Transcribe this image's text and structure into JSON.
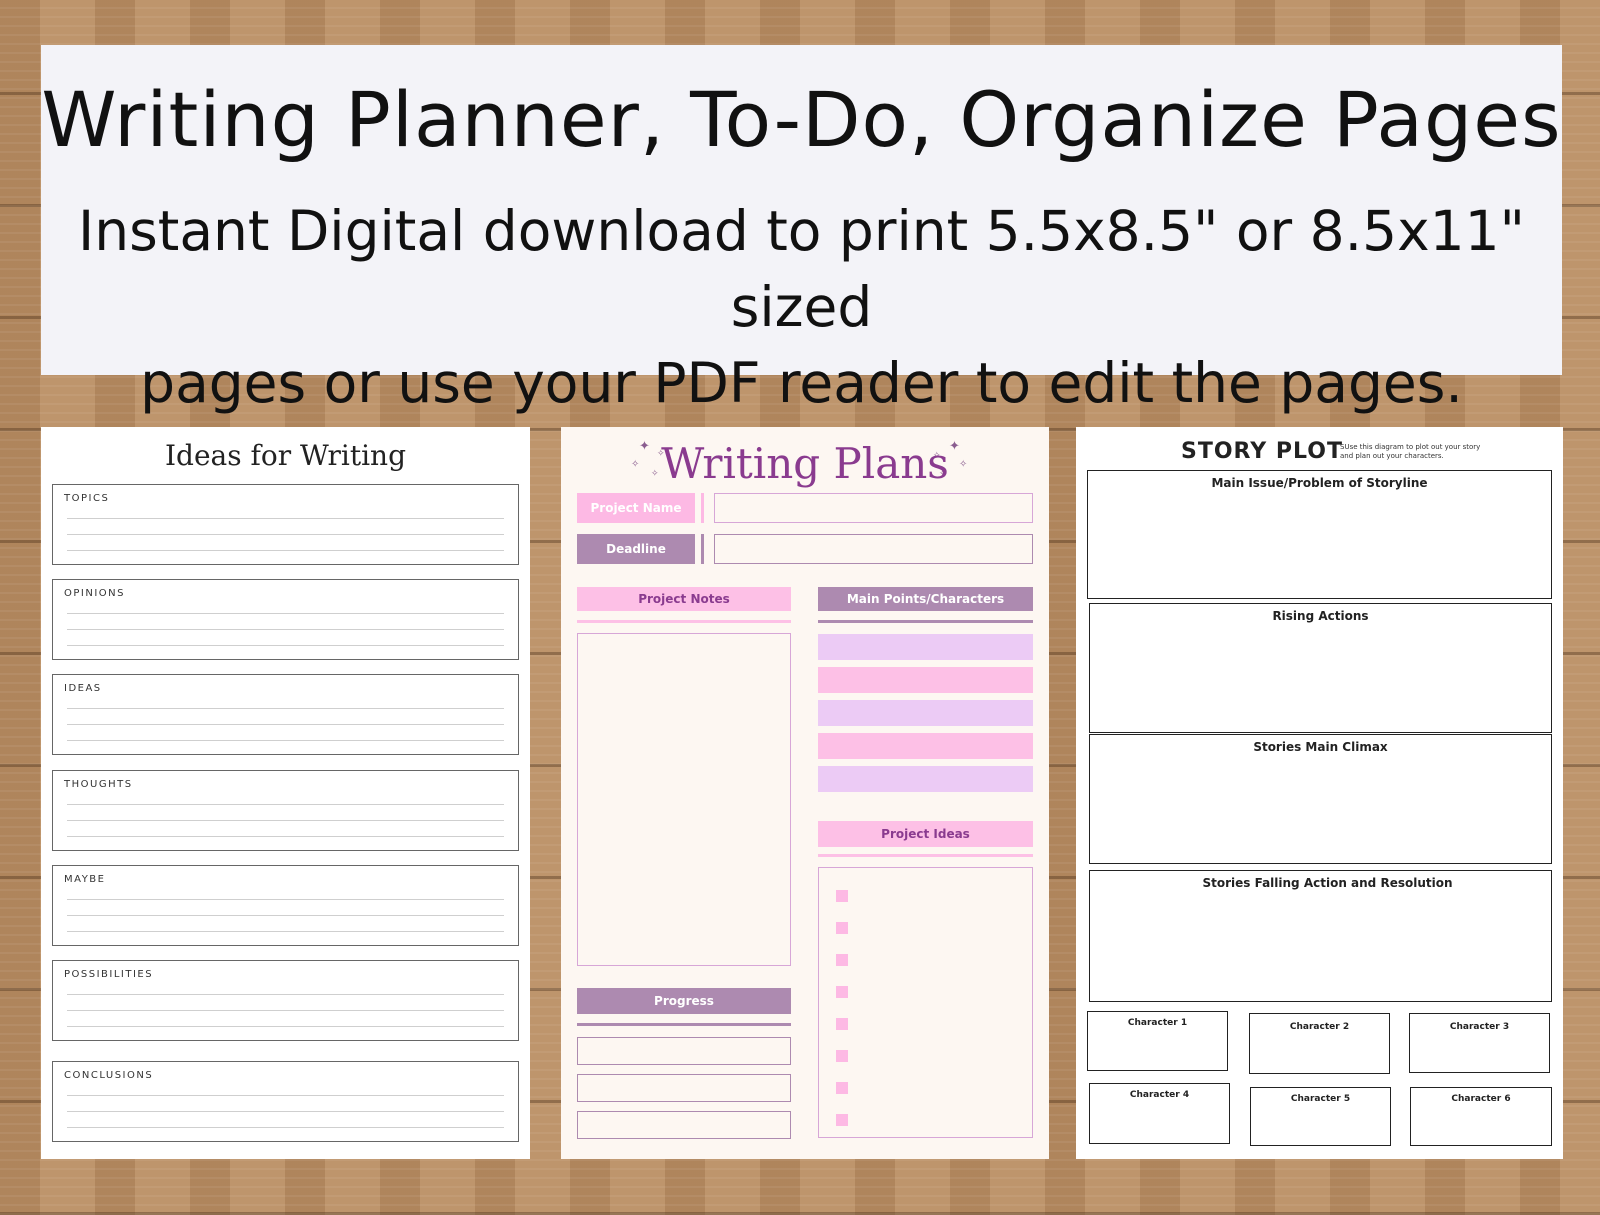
{
  "banner": {
    "title": "Writing Planner, To-Do, Organize Pages",
    "subtitle_line1": "Instant Digital download to print 5.5x8.5\" or 8.5x11\" sized",
    "subtitle_line2": "pages or use your PDF reader to edit the pages."
  },
  "ideas_page": {
    "title": "Ideas for Writing",
    "sections": [
      "TOPICS",
      "OPINIONS",
      "IDEAS",
      "THOUGHTS",
      "MAYBE",
      "POSSIBILITIES",
      "CONCLUSIONS"
    ]
  },
  "plans_page": {
    "title": "Writing Plans",
    "project_name_label": "Project Name",
    "deadline_label": "Deadline",
    "project_notes_label": "Project Notes",
    "main_points_label": "Main Points/Characters",
    "project_ideas_label": "Project Ideas",
    "progress_label": "Progress",
    "colors": {
      "pink": "#fdc0e6",
      "purple": "#ad8ab0",
      "lavender": "#eccbf5",
      "title": "#8a3b8f"
    }
  },
  "story_page": {
    "title": "STORY PLOT",
    "note_line1": "SUse this diagram to plot out your story",
    "note_line2": "and plan out your characters.",
    "boxes": [
      "Main Issue/Problem of Storyline",
      "Rising Actions",
      "Stories Main Climax",
      "Stories Falling Action and Resolution"
    ],
    "characters": [
      "Character 1",
      "Character 2",
      "Character 3",
      "Character 4",
      "Character 5",
      "Character 6"
    ]
  }
}
